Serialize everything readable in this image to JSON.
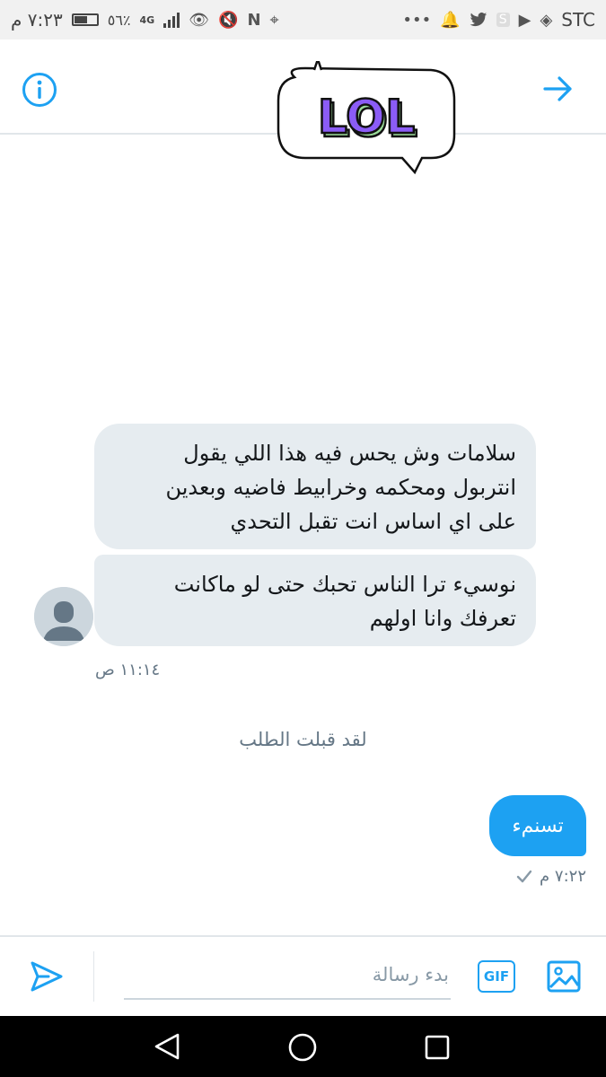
{
  "status_bar": {
    "time": "٧:٢٣ م",
    "battery_percent": "٥٦٪",
    "network": "4G",
    "carrier": "STC"
  },
  "header": {
    "sticker_text": "LOL"
  },
  "conversation": {
    "incoming": [
      {
        "lines": [
          "سلامات وش يحس فيه هذا اللي يقول",
          "انتربول ومحكمه وخرابيط فاضيه وبعدين",
          "على اي اساس انت تقبل التحدي"
        ]
      },
      {
        "lines": [
          "نوسيء ترا الناس تحبك حتى لو ماكانت",
          "تعرفك وانا اولهم"
        ]
      }
    ],
    "incoming_time": "١١:١٤ ص",
    "system_notice": "لقد قبلت الطلب",
    "outgoing": {
      "text": "تسنمء",
      "time": "٧:٢٢ م"
    }
  },
  "composer": {
    "placeholder": "بدء رسالة",
    "gif_label": "GIF"
  },
  "colors": {
    "accent": "#1da1f2",
    "incoming_bubble": "#e6ecf0",
    "muted_text": "#657786"
  }
}
